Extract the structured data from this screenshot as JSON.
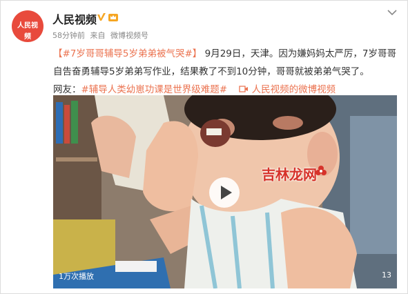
{
  "account": {
    "name": "人民视频",
    "avatar_text": "人民视频",
    "post_time": "58分钟前",
    "source_prefix": "来自",
    "source": "微博视频号"
  },
  "post": {
    "topic": "【#7岁哥哥辅导5岁弟弟被气哭#】",
    "body": "9月29日，天津。因为嫌妈妈太严厉，7岁哥哥自告奋勇辅导5岁弟弟写作业，结果教了不到10分钟，哥哥就被弟弟气哭了。",
    "netizen_label": "网友：",
    "netizen_topic": "#辅导人类幼崽功课是世界级难题#",
    "video_link": "人民视频的微博视频"
  },
  "video": {
    "views": "1万次播放",
    "duration": "13",
    "watermark": "吉林龙网"
  },
  "colors": {
    "link": "#eb7350",
    "avatar_bg": "#e84a3c",
    "verify": "#f6a623"
  },
  "icons": [
    "verified-v-icon",
    "vip-crown-icon",
    "chevron-down-icon",
    "play-icon",
    "video-link-icon",
    "watermark-flower-icon"
  ]
}
